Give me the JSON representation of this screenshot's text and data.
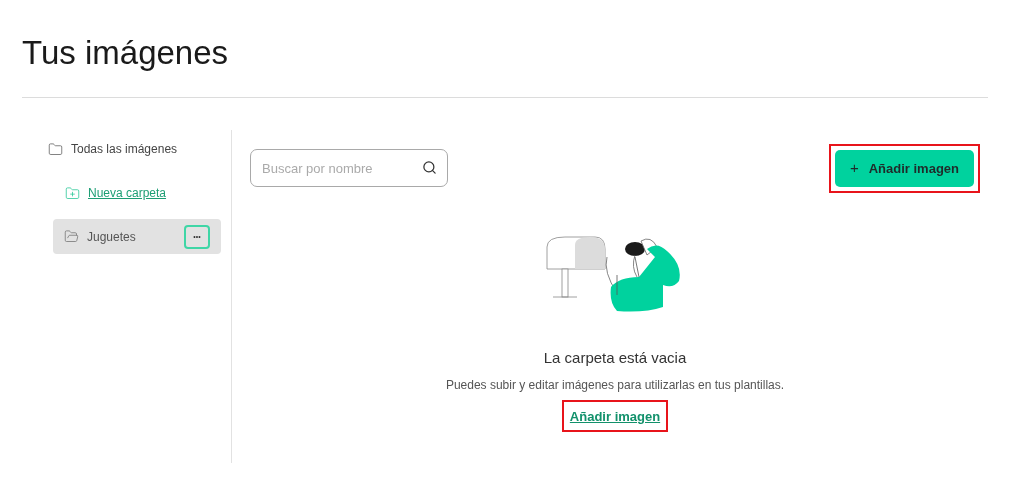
{
  "page_title": "Tus imágenes",
  "sidebar": {
    "all_images": "Todas las imágenes",
    "new_folder": "Nueva carpeta",
    "folders": [
      {
        "name": "Juguetes",
        "selected": true,
        "menu": "•••"
      }
    ]
  },
  "search": {
    "placeholder": "Buscar por nombre"
  },
  "add_button": {
    "icon": "+",
    "label": "Añadir imagen",
    "highlighted": true
  },
  "empty_state": {
    "title": "La carpeta está vacia",
    "message": "Puedes subir y editar imágenes para utilizarlas en tus plantillas.",
    "link": "Añadir imagen",
    "link_highlighted": true
  }
}
